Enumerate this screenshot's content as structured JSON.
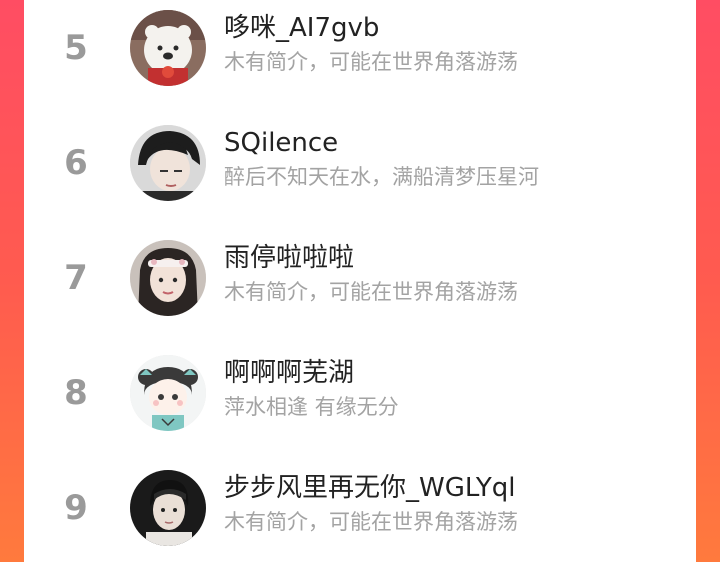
{
  "ranking": {
    "users": [
      {
        "rank": "5",
        "name": "哆咪_AI7gvb",
        "bio": "木有简介，可能在世界角落游荡",
        "avatar": "polar-bear-avatar"
      },
      {
        "rank": "6",
        "name": "SQilence",
        "bio": "醉后不知天在水，满船清梦压星河",
        "avatar": "dark-hair-avatar"
      },
      {
        "rank": "7",
        "name": "雨停啦啦啦",
        "bio": "木有简介，可能在世界角落游荡",
        "avatar": "headband-girl-avatar"
      },
      {
        "rank": "8",
        "name": "啊啊啊芜湖",
        "bio": "萍水相逢 有缘无分",
        "avatar": "cartoon-girl-avatar"
      },
      {
        "rank": "9",
        "name": "步步风里再无你_WGLYql",
        "bio": "木有简介，可能在世界角落游荡",
        "avatar": "portrait-avatar"
      }
    ]
  },
  "colors": {
    "gradient_top": "#ff4d63",
    "gradient_bottom": "#ff7a3d",
    "rank_color": "#9a9a9a",
    "name_color": "#222222",
    "bio_color": "#a3a3a3"
  }
}
